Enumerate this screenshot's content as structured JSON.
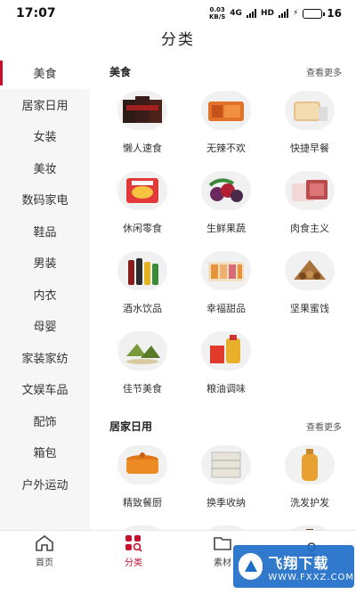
{
  "status_bar": {
    "time": "17:07",
    "net_speed_value": "0.03",
    "net_speed_unit": "KB/S",
    "net_type": "4G",
    "hd": "HD",
    "battery": "16"
  },
  "header": {
    "title": "分类"
  },
  "sidebar": {
    "items": [
      {
        "label": "美食"
      },
      {
        "label": "居家日用"
      },
      {
        "label": "女装"
      },
      {
        "label": "美妆"
      },
      {
        "label": "数码家电"
      },
      {
        "label": "鞋品"
      },
      {
        "label": "男装"
      },
      {
        "label": "内衣"
      },
      {
        "label": "母婴"
      },
      {
        "label": "家装家纺"
      },
      {
        "label": "文娱车品"
      },
      {
        "label": "配饰"
      },
      {
        "label": "箱包"
      },
      {
        "label": "户外运动"
      }
    ],
    "active_index": 0
  },
  "sections": [
    {
      "title": "美食",
      "more": "查看更多",
      "items": [
        {
          "label": "懒人速食",
          "icon": "instant-food-icon"
        },
        {
          "label": "无辣不欢",
          "icon": "spicy-food-icon"
        },
        {
          "label": "快捷早餐",
          "icon": "breakfast-icon"
        },
        {
          "label": "休闲零食",
          "icon": "snacks-icon"
        },
        {
          "label": "生鲜果蔬",
          "icon": "fruit-icon"
        },
        {
          "label": "肉食主义",
          "icon": "meat-icon"
        },
        {
          "label": "酒水饮品",
          "icon": "drinks-icon"
        },
        {
          "label": "幸福甜品",
          "icon": "dessert-icon"
        },
        {
          "label": "坚果蜜饯",
          "icon": "nuts-icon"
        },
        {
          "label": "佳节美食",
          "icon": "festival-food-icon"
        },
        {
          "label": "粮油调味",
          "icon": "oil-icon"
        }
      ]
    },
    {
      "title": "居家日用",
      "more": "查看更多",
      "items": [
        {
          "label": "精致餐厨",
          "icon": "pot-icon"
        },
        {
          "label": "换季收纳",
          "icon": "storage-icon"
        },
        {
          "label": "洗发护发",
          "icon": "shampoo-icon"
        },
        {
          "label": "",
          "icon": "tissue-icon"
        },
        {
          "label": "",
          "icon": "mask-icon"
        },
        {
          "label": "",
          "icon": "disinfectant-icon"
        }
      ]
    }
  ],
  "bottom_nav": [
    {
      "label": "首页",
      "icon": "home-icon"
    },
    {
      "label": "分类",
      "icon": "category-icon"
    },
    {
      "label": "素材",
      "icon": "folder-icon"
    },
    {
      "label": "",
      "icon": "user-icon"
    }
  ],
  "watermark": {
    "title": "飞翔下载",
    "sub": "WWW.FXXZ.COM"
  },
  "colors": {
    "accent": "#c8102e",
    "sidebar_bg": "#f6f6f6"
  }
}
